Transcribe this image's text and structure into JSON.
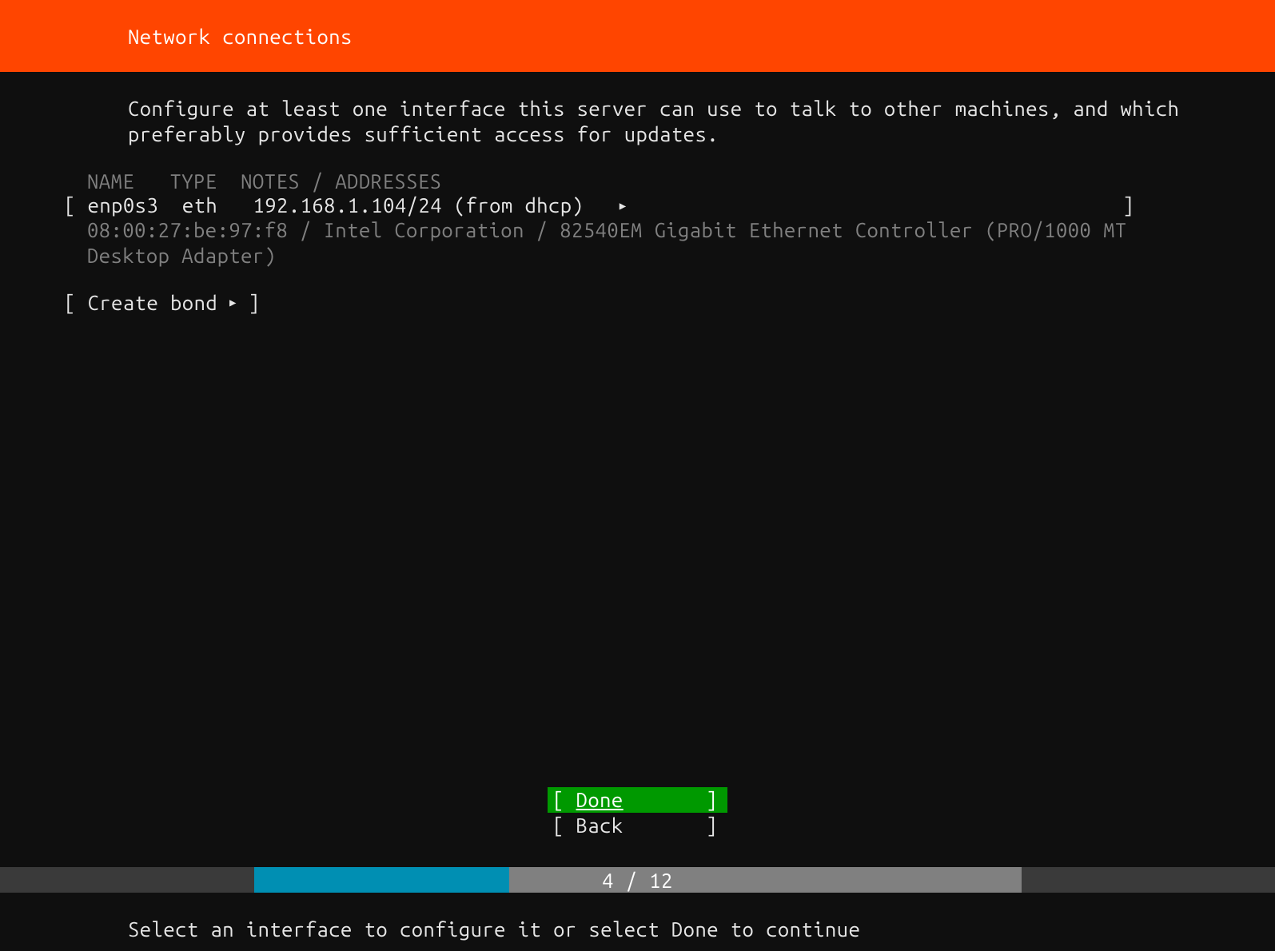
{
  "header": {
    "title": "Network connections"
  },
  "description": "Configure at least one interface this server can use to talk to other machines, and which preferably provides sufficient access for updates.",
  "columns": {
    "name": "NAME",
    "type": "TYPE",
    "notes": "NOTES / ADDRESSES"
  },
  "interface": {
    "name": "enp0s3",
    "type": "eth",
    "notes": "192.168.1.104/24 (from dhcp)",
    "details": "08:00:27:be:97:f8 / Intel Corporation / 82540EM Gigabit Ethernet Controller (PRO/1000 MT Desktop Adapter)"
  },
  "create_bond": {
    "label": "Create bond"
  },
  "buttons": {
    "done": "Done",
    "back": "Back"
  },
  "progress": {
    "current": 4,
    "total": 12,
    "label": "4 / 12"
  },
  "hint": "Select an interface to configure it or select Done to continue"
}
